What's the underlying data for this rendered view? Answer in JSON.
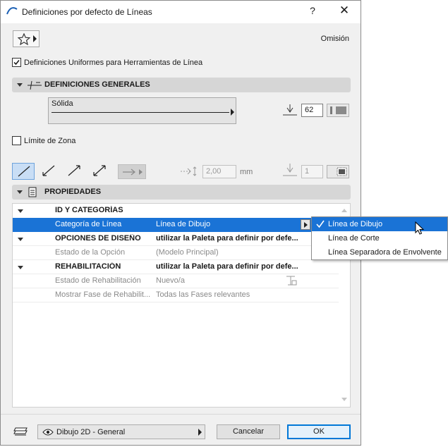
{
  "window": {
    "title": "Definiciones por defecto de Líneas",
    "help_label": "?",
    "close_label": "✕"
  },
  "favorites": {
    "icon": "star-icon"
  },
  "default_label": "Omisión",
  "uniform_settings": {
    "label": "Definiciones Uniformes para Herramientas de Línea",
    "checked": true
  },
  "general_section": {
    "title": "DEFINICIONES GENERALES",
    "line_type": "Sólida",
    "pen_number": "62"
  },
  "zone_boundary": {
    "label": "Límite de Zona",
    "checked": false
  },
  "arrow_settings": {
    "size_value": "2,00",
    "unit": "mm",
    "arrow_pen": "1"
  },
  "properties_section": {
    "title": "PROPIEDADES",
    "rows": [
      {
        "type": "group",
        "label": "ID Y CATEGORÍAS",
        "value": ""
      },
      {
        "type": "selected",
        "label": "Categoría de Línea",
        "value": "Línea de Dibujo"
      },
      {
        "type": "group",
        "label": "OPCIONES DE DISEÑO",
        "value": "utilizar la Paleta para definir por defe..."
      },
      {
        "type": "dim",
        "label": "Estado de la Opción",
        "value": "(Modelo Principal)"
      },
      {
        "type": "group",
        "label": "REHABILITACIÓN",
        "value": "utilizar la Paleta para definir por defe..."
      },
      {
        "type": "dim",
        "label": "Estado de Rehabilitación",
        "value": "Nuevo/a"
      },
      {
        "type": "dim",
        "label": "Mostrar Fase de Rehabilit...",
        "value": "Todas las Fases relevantes"
      }
    ]
  },
  "category_popup": {
    "options": [
      "Línea de Dibujo",
      "Línea de Corte",
      "Línea Separadora de Envolvente"
    ],
    "selected_index": 0
  },
  "footer": {
    "view_label": "Dibujo 2D - General",
    "cancel_label": "Cancelar",
    "ok_label": "OK"
  },
  "colors": {
    "selection": "#1a73d6",
    "ok_border": "#0078d7",
    "section_header": "#d6d6d6"
  }
}
